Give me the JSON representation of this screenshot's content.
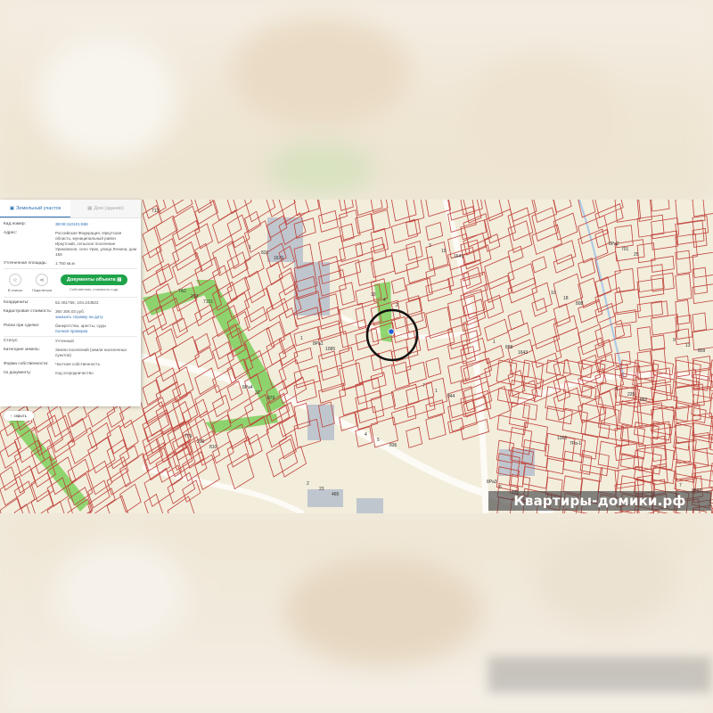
{
  "panel": {
    "tabs": [
      {
        "label": "Земельный участок",
        "active": true,
        "icon": "parcel-icon"
      },
      {
        "label": "Дом (здание)",
        "active": false,
        "icon": "building-icon"
      }
    ],
    "fields": {
      "cad_number": {
        "label": "Кад.номер:",
        "value": "38:06:110101:868"
      },
      "address": {
        "label": "Адрес:",
        "value": "Российская Федерация, Иркутская область, муниципальный район Иркутский, сельское поселение Уриковское, село Урик, улица Ленина, дом 158"
      },
      "area": {
        "label": "Уточненная площадь:",
        "value": "1 750 кв.м"
      },
      "coords": {
        "label": "Координаты:",
        "value": "52.461756, 104.243822"
      },
      "cad_cost": {
        "label": "Кадастровая стоимость:",
        "value": "360 306.03 руб.",
        "sub": "заказать справку на дату"
      },
      "risks": {
        "label": "Риски при сделке:",
        "value": "банкротства, аресты, суды",
        "sub": "полная проверка"
      },
      "status": {
        "label": "Статус:",
        "value": "Учтенный"
      },
      "category": {
        "label": "Категория земель:",
        "value": "Земли поселений (земли населенных пунктов)"
      },
      "ownership": {
        "label": "Форма собственности:",
        "value": "Частная собственность"
      },
      "by_document": {
        "label": "по документу:",
        "value": "под огородничество"
      }
    },
    "actions": {
      "add_to_list": "В список",
      "share": "Поделиться",
      "docs_button": "Документы объекта",
      "docs_caption": "Собственник, стоимость и др."
    },
    "hide_button": "скрыть"
  },
  "map": {
    "parcel_numbers": [
      "713",
      "1676",
      "2",
      "1643",
      "862",
      "810",
      "465",
      "1641",
      "808",
      "809",
      "879",
      "836",
      "131",
      "25",
      "7151",
      "1085",
      "844",
      "7Ра-1",
      "2898",
      "821",
      "4",
      "888",
      "225",
      "200",
      "23",
      "19",
      "18",
      "13",
      "22",
      "5",
      "6",
      "701",
      "213",
      "8Ра1",
      "1",
      "1065",
      "7",
      "1",
      "10",
      "1",
      "8",
      "779",
      "2",
      "3",
      "10",
      "9",
      "8Ра4",
      "4",
      "8Ра3",
      "8Ра2",
      "7А2",
      "1",
      "7"
    ],
    "highlight_color": "#7ccf5a",
    "boundary_color": "#c0443c",
    "marker_color": "#1f5fd6"
  },
  "watermark": {
    "text": "Квартиры-домики.рф"
  }
}
